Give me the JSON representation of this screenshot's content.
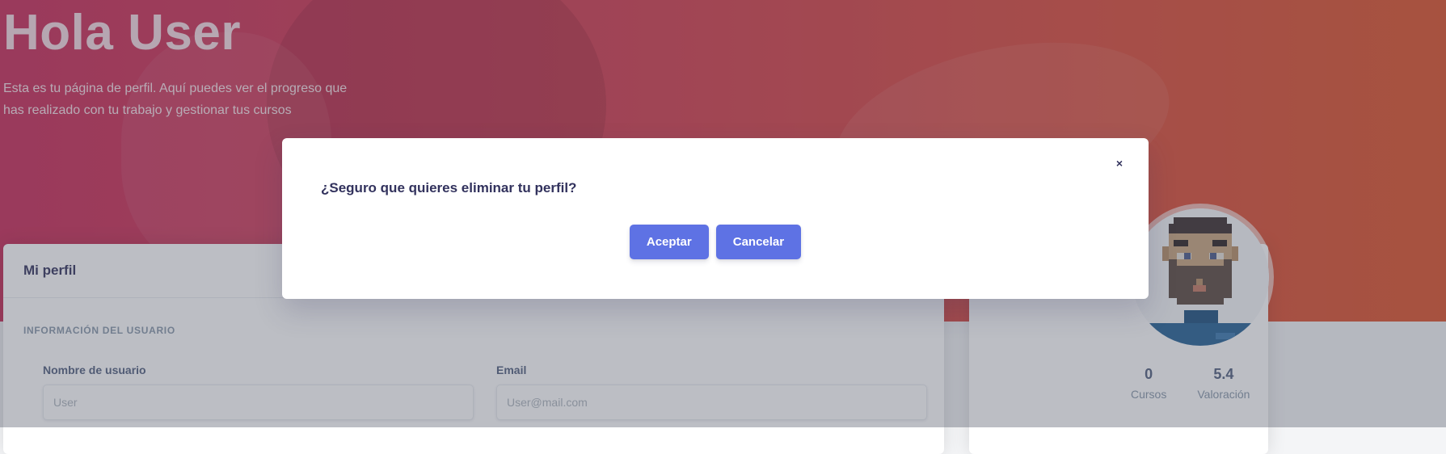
{
  "hero": {
    "title": "Hola User",
    "description": "Esta es tu página de perfil. Aquí puedes ver el progreso que has realizado con tu trabajo y gestionar tus cursos"
  },
  "profile_card": {
    "title": "Mi perfil",
    "section_label": "INFORMACIÓN DEL USUARIO",
    "fields": [
      {
        "label": "Nombre de usuario",
        "placeholder": "User"
      },
      {
        "label": "Email",
        "placeholder": "User@mail.com"
      }
    ]
  },
  "user_card": {
    "avatar_icon": "pixel-art-bearded-man-avatar",
    "stats": [
      {
        "value": "0",
        "label": "Cursos"
      },
      {
        "value": "5.4",
        "label": "Valoración"
      }
    ]
  },
  "modal": {
    "close_icon": "close-icon",
    "close_glyph": "×",
    "message": "¿Seguro que quieres eliminar tu perfil?",
    "accept_label": "Aceptar",
    "cancel_label": "Cancelar"
  },
  "colors": {
    "primary": "#5e72e4",
    "hero_start": "#c92a57",
    "hero_end": "#dd5229",
    "text_dark": "#32325d"
  }
}
